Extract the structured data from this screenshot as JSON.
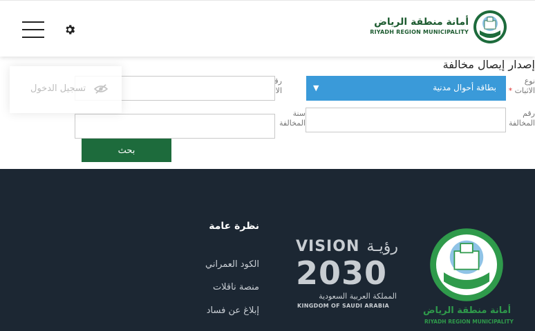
{
  "header": {
    "logo_ar": "أمانة منطقة الرياض",
    "logo_en": "RIYADH REGION MUNICIPALITY",
    "emblem_text": "الرياض",
    "menu_icon": "hamburger-menu-icon",
    "settings_icon": "gear-icon"
  },
  "form": {
    "title": "إصدار إيصال مخالفة",
    "id_type_label": "نوع",
    "id_type_label_2": "الاثبات",
    "id_type_value": "بطاقة أحوال مدنية",
    "id_number_label": "رقم",
    "id_number_label_2": "الاثبات",
    "violation_number_label": "رقم",
    "violation_number_label_2": "المخالفة",
    "violation_year_label": "سنة",
    "violation_year_label_2": "المخالفة",
    "required_mark": "*",
    "id_number_value": "",
    "violation_number_value": "",
    "violation_year_value": "",
    "search_button": "بحث"
  },
  "login": {
    "label": "تسجيل الدخول",
    "icon": "eye-slash-icon"
  },
  "footer": {
    "heading": "نظرة عامة",
    "links": [
      "الكود العمراني",
      "منصة ناقلات",
      "إبلاغ عن فساد"
    ],
    "vision_en": "VISION",
    "vision_ar": "رؤيـة",
    "vision_year": "2030",
    "vision_ar_sub": "المملكة العربية السعودية",
    "vision_en_sub": "KINGDOM OF SAUDI ARABIA",
    "logo_ar": "أمانة منطقة الرياض",
    "logo_en": "RIYADH REGION MUNICIPALITY"
  },
  "colors": {
    "select_blue": "#3a9ad9",
    "button_green": "#1d6b3c",
    "footer_bg": "#1c2733",
    "brand_green": "#1d5b30"
  }
}
